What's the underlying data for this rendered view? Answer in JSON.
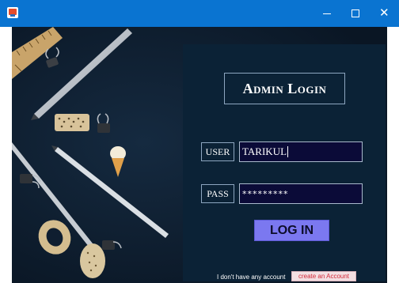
{
  "window": {
    "controls": {
      "minimize": "—",
      "maximize": "",
      "close": "✕"
    }
  },
  "panel": {
    "title": "Admin Login",
    "user_label": "USER",
    "user_value": "TARIKUL",
    "pass_label": "PASS",
    "pass_value": "*********",
    "login_label": "LOG IN",
    "no_account_text": "I don't have any account",
    "create_account_label": "create  an Account"
  },
  "colors": {
    "titlebar": "#0a74d1",
    "background": "#0d1c2e",
    "panel": "#0b2236",
    "input": "#0b0b38",
    "login_button": "#7b78f0",
    "create_button": "#f2dfe2",
    "create_text": "#d32a3a"
  },
  "icons": [
    "app-icon",
    "minimize-icon",
    "maximize-icon",
    "close-icon"
  ]
}
